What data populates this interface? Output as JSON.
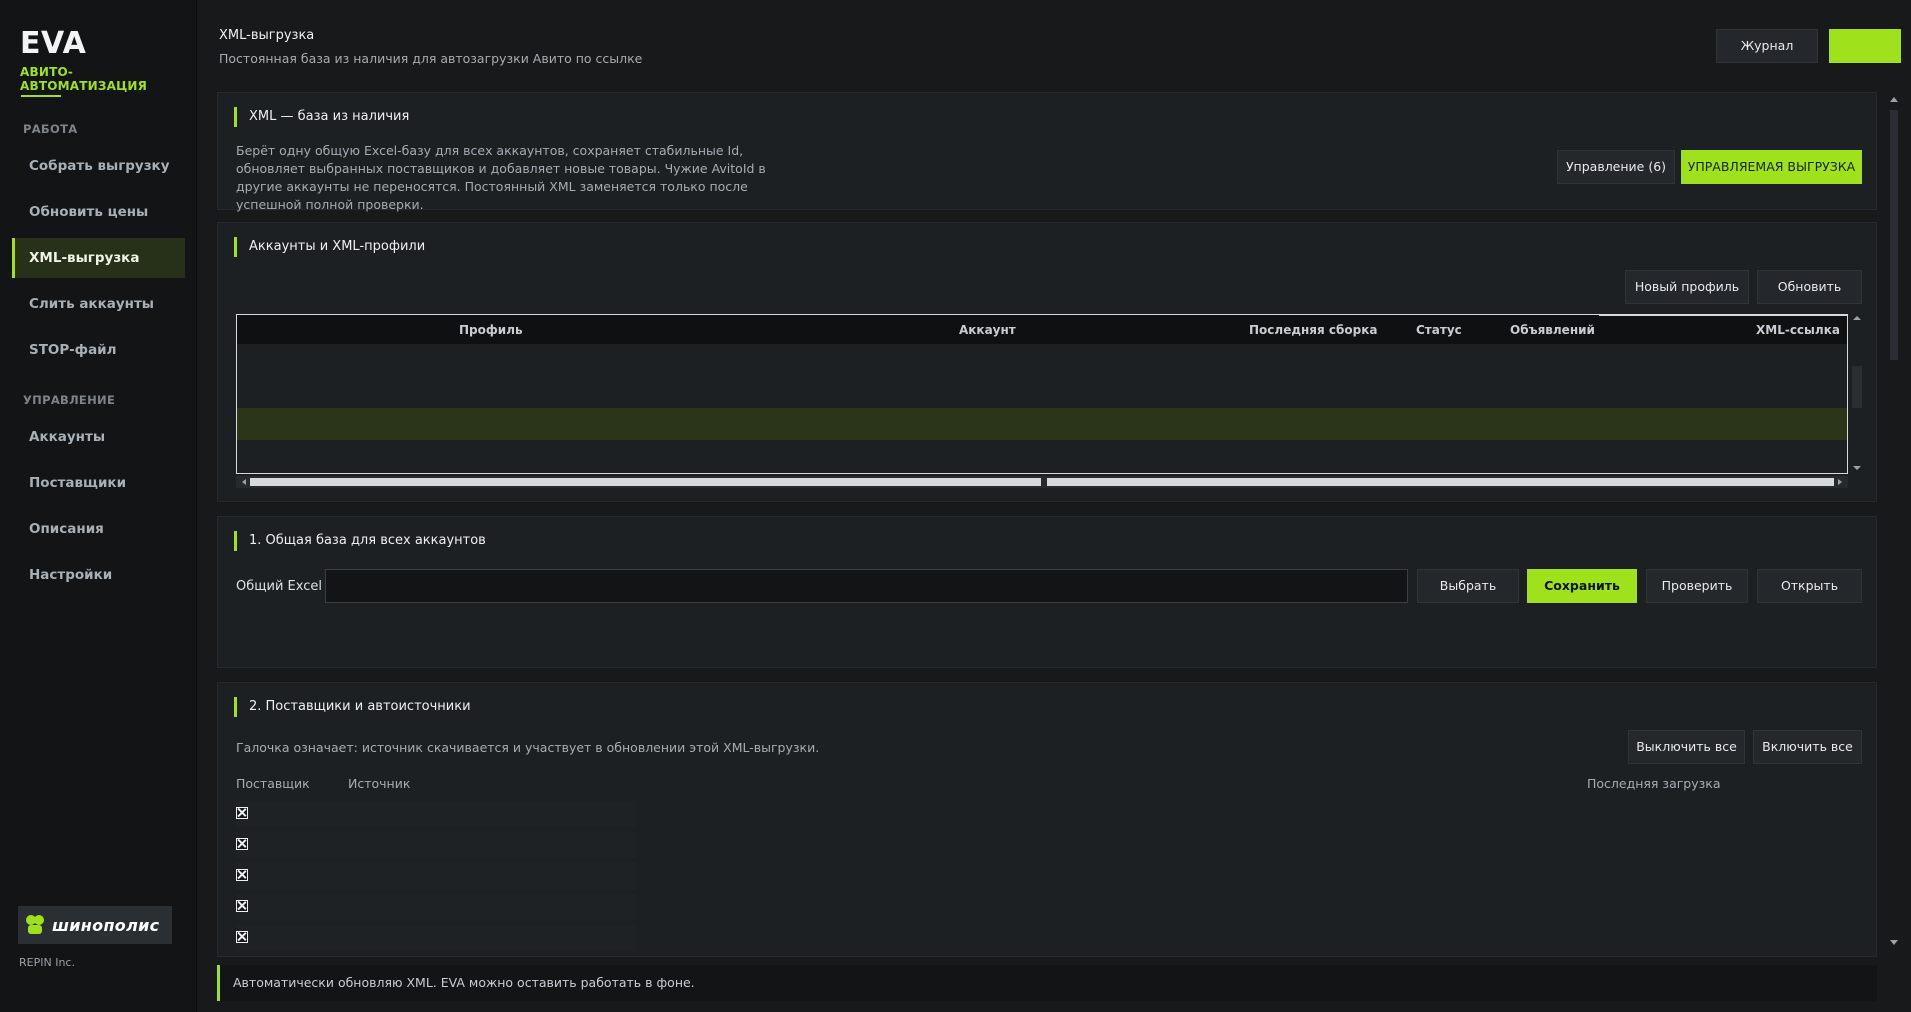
{
  "brand": {
    "title": "EVA",
    "subtitle": "АВИТО-АВТОМАТИЗАЦИЯ",
    "accent": "#9fe11b"
  },
  "sidebar": {
    "section_work": "РАБОТА",
    "work_items": [
      {
        "label": "Собрать выгрузку",
        "active": false
      },
      {
        "label": "Обновить цены",
        "active": false
      },
      {
        "label": "XML-выгрузка",
        "active": true
      },
      {
        "label": "Слить аккаунты",
        "active": false
      },
      {
        "label": "STOP-файл",
        "active": false
      }
    ],
    "section_manage": "УПРАВЛЕНИЕ",
    "manage_items": [
      {
        "label": "Аккаунты"
      },
      {
        "label": "Поставщики"
      },
      {
        "label": "Описания"
      },
      {
        "label": "Настройки"
      }
    ],
    "logo_text": "шинополис",
    "company": "REPIN Inc."
  },
  "header": {
    "title": "XML-выгрузка",
    "subtitle": "Постоянная база из наличия для автозагрузки Авито по ссылке",
    "journal_button": "Журнал",
    "green_button": ""
  },
  "card_xml": {
    "title": "XML — база из наличия",
    "description": "Берёт одну общую Excel-базу для всех аккаунтов, сохраняет стабильные Id, обновляет выбранных поставщиков и добавляет новые товары. Чужие AvitoId в другие аккаунты не переносятся. Постоянный XML заменяется только после успешной полной проверки.",
    "manage_button": "Управление (6)",
    "managed_button": "УПРАВЛЯЕМАЯ ВЫГРУЗКА"
  },
  "card_accounts": {
    "title": "Аккаунты и XML-профили",
    "new_profile_button": "Новый профиль",
    "refresh_button": "Обновить",
    "columns": [
      "Профиль",
      "Аккаунт",
      "Последняя сборка",
      "Статус",
      "Объявлений",
      "XML-ссылка"
    ],
    "rows": [
      {
        "selected": false
      },
      {
        "selected": false
      },
      {
        "selected": true
      },
      {
        "selected": false
      }
    ]
  },
  "card_base": {
    "title": "1. Общая база для всех аккаунтов",
    "label": "Общий Excel",
    "value": "",
    "choose_button": "Выбрать",
    "save_button": "Сохранить",
    "check_button": "Проверить",
    "open_button": "Открыть"
  },
  "card_suppliers": {
    "title": "2. Поставщики и автоисточники",
    "hint": "Галочка означает: источник скачивается и участвует в обновлении этой XML-выгрузки.",
    "disable_all_button": "Выключить все",
    "enable_all_button": "Включить все",
    "col_supplier": "Поставщик",
    "col_source": "Источник",
    "col_last_load": "Последняя загрузка",
    "rows": [
      {
        "checked": true
      },
      {
        "checked": true
      },
      {
        "checked": true
      },
      {
        "checked": true
      },
      {
        "checked": true
      }
    ]
  },
  "footer": {
    "status": "Автоматически обновляю XML. EVA можно оставить работать в фоне."
  }
}
